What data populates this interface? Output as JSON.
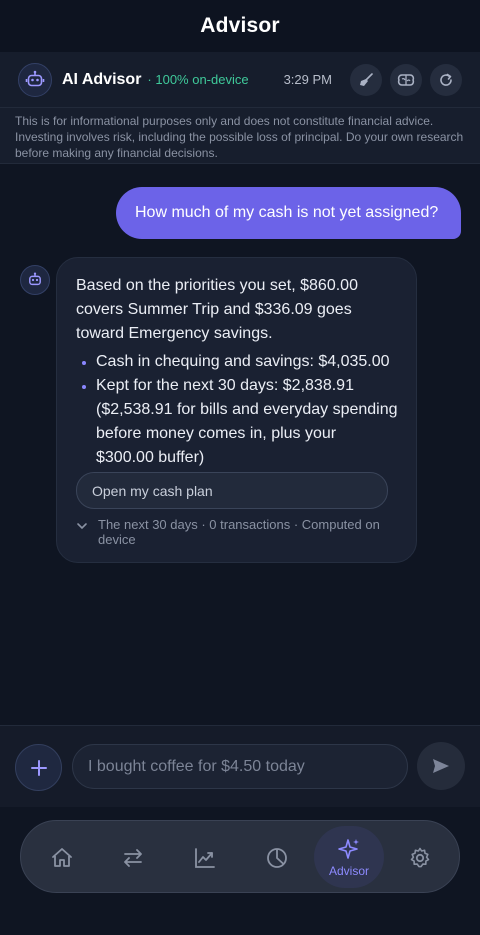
{
  "topbar": {
    "title": "Advisor"
  },
  "chat_header": {
    "name": "AI Advisor",
    "status": "· 100% on-device",
    "time": "3:29 PM",
    "icons": [
      "broom-icon",
      "brain-icon",
      "refresh-icon"
    ]
  },
  "disclaimer": "This is for informational purposes only and does not constitute financial advice. Investing involves risk, including the possible loss of principal. Do your own research before making any financial decisions.",
  "messages": {
    "user": "How much of my cash is not yet assigned?",
    "assistant": {
      "intro": "Based on the priorities you set, $860.00 covers Summer Trip and $336.09 goes toward Emergency savings.",
      "bullets": [
        "Cash in chequing and savings: $4,035.00",
        "Kept for the next 30 days: $2,838.91 ($2,538.91 for bills and everyday spending before money comes in, plus your $300.00 buffer)"
      ],
      "action_label": "Open my cash plan",
      "meta": "The next 30 days · 0 transactions · Computed on device"
    }
  },
  "composer": {
    "placeholder": "I bought coffee for $4.50 today"
  },
  "tabbar": {
    "tabs": [
      {
        "icon": "home-icon"
      },
      {
        "icon": "transfer-icon"
      },
      {
        "icon": "trend-chart-icon"
      },
      {
        "icon": "pie-chart-icon"
      },
      {
        "icon": "sparkle-icon",
        "label": "Advisor",
        "active": true
      },
      {
        "icon": "gear-icon"
      }
    ]
  },
  "colors": {
    "accent": "#6c63e8",
    "status_green": "#3fc99a",
    "background": "#0f1522"
  }
}
